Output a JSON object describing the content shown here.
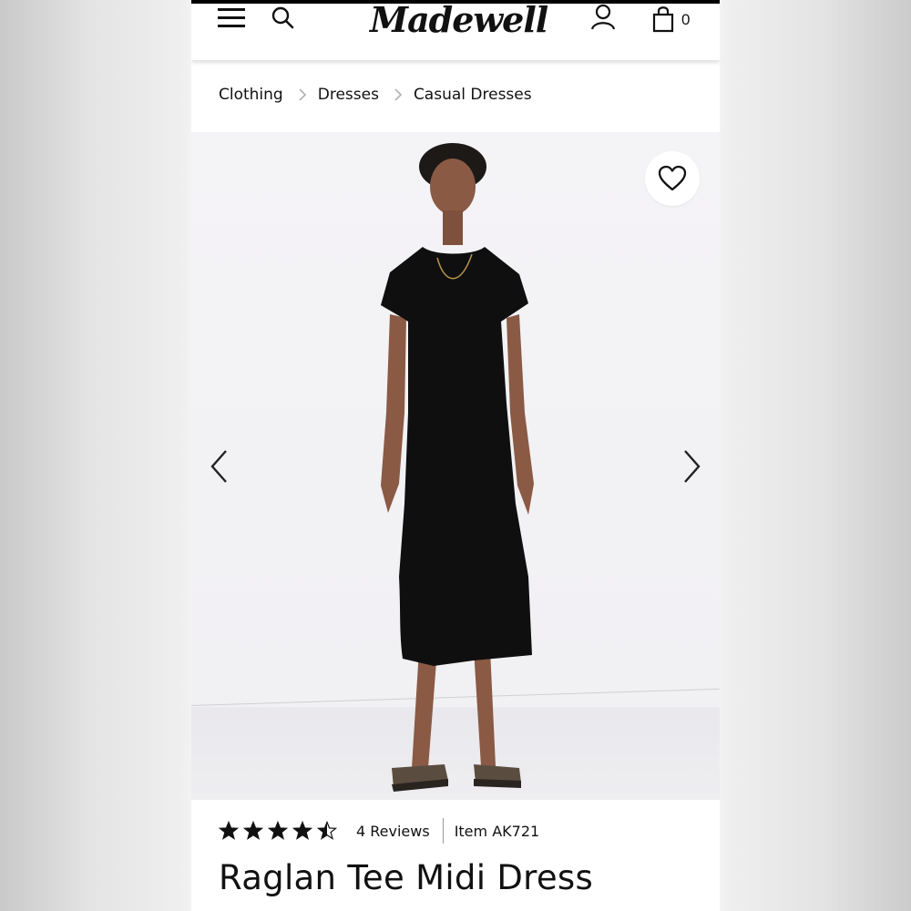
{
  "header": {
    "logo_text": "Madewell",
    "bag_count": "0",
    "icons": [
      "hamburger-menu-icon",
      "search-icon",
      "account-icon",
      "shopping-bag-icon"
    ]
  },
  "breadcrumb": {
    "items": [
      "Clothing",
      "Dresses",
      "Casual Dresses"
    ]
  },
  "product": {
    "rating": 4.5,
    "rating_max": 5,
    "reviews_label": "4 Reviews",
    "item_label": "Item AK721",
    "title": "Raglan Tee Midi Dress"
  },
  "colors": {
    "accent": "#111111",
    "background": "#ffffff"
  }
}
